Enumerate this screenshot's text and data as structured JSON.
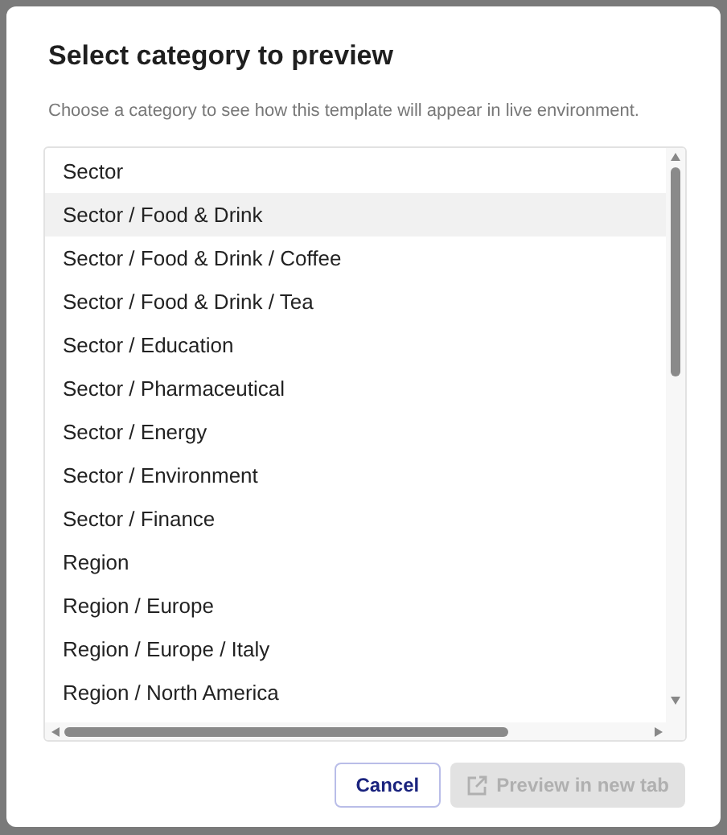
{
  "dialog": {
    "title": "Select category to preview",
    "description": "Choose a category to see how this template will appear in live environment."
  },
  "categories": [
    {
      "label": "Sector",
      "selected": false
    },
    {
      "label": "Sector / Food & Drink",
      "selected": true
    },
    {
      "label": "Sector / Food & Drink / Coffee",
      "selected": false
    },
    {
      "label": "Sector / Food & Drink / Tea",
      "selected": false
    },
    {
      "label": "Sector / Education",
      "selected": false
    },
    {
      "label": "Sector / Pharmaceutical",
      "selected": false
    },
    {
      "label": "Sector / Energy",
      "selected": false
    },
    {
      "label": "Sector / Environment",
      "selected": false
    },
    {
      "label": "Sector / Finance",
      "selected": false
    },
    {
      "label": "Region",
      "selected": false
    },
    {
      "label": "Region / Europe",
      "selected": false
    },
    {
      "label": "Region / Europe / Italy",
      "selected": false
    },
    {
      "label": "Region / North America",
      "selected": false
    }
  ],
  "buttons": [
    {
      "label": "Cancel",
      "kind": "secondary",
      "disabled": false
    },
    {
      "label": "Preview in new tab",
      "kind": "primary",
      "disabled": true
    }
  ]
}
